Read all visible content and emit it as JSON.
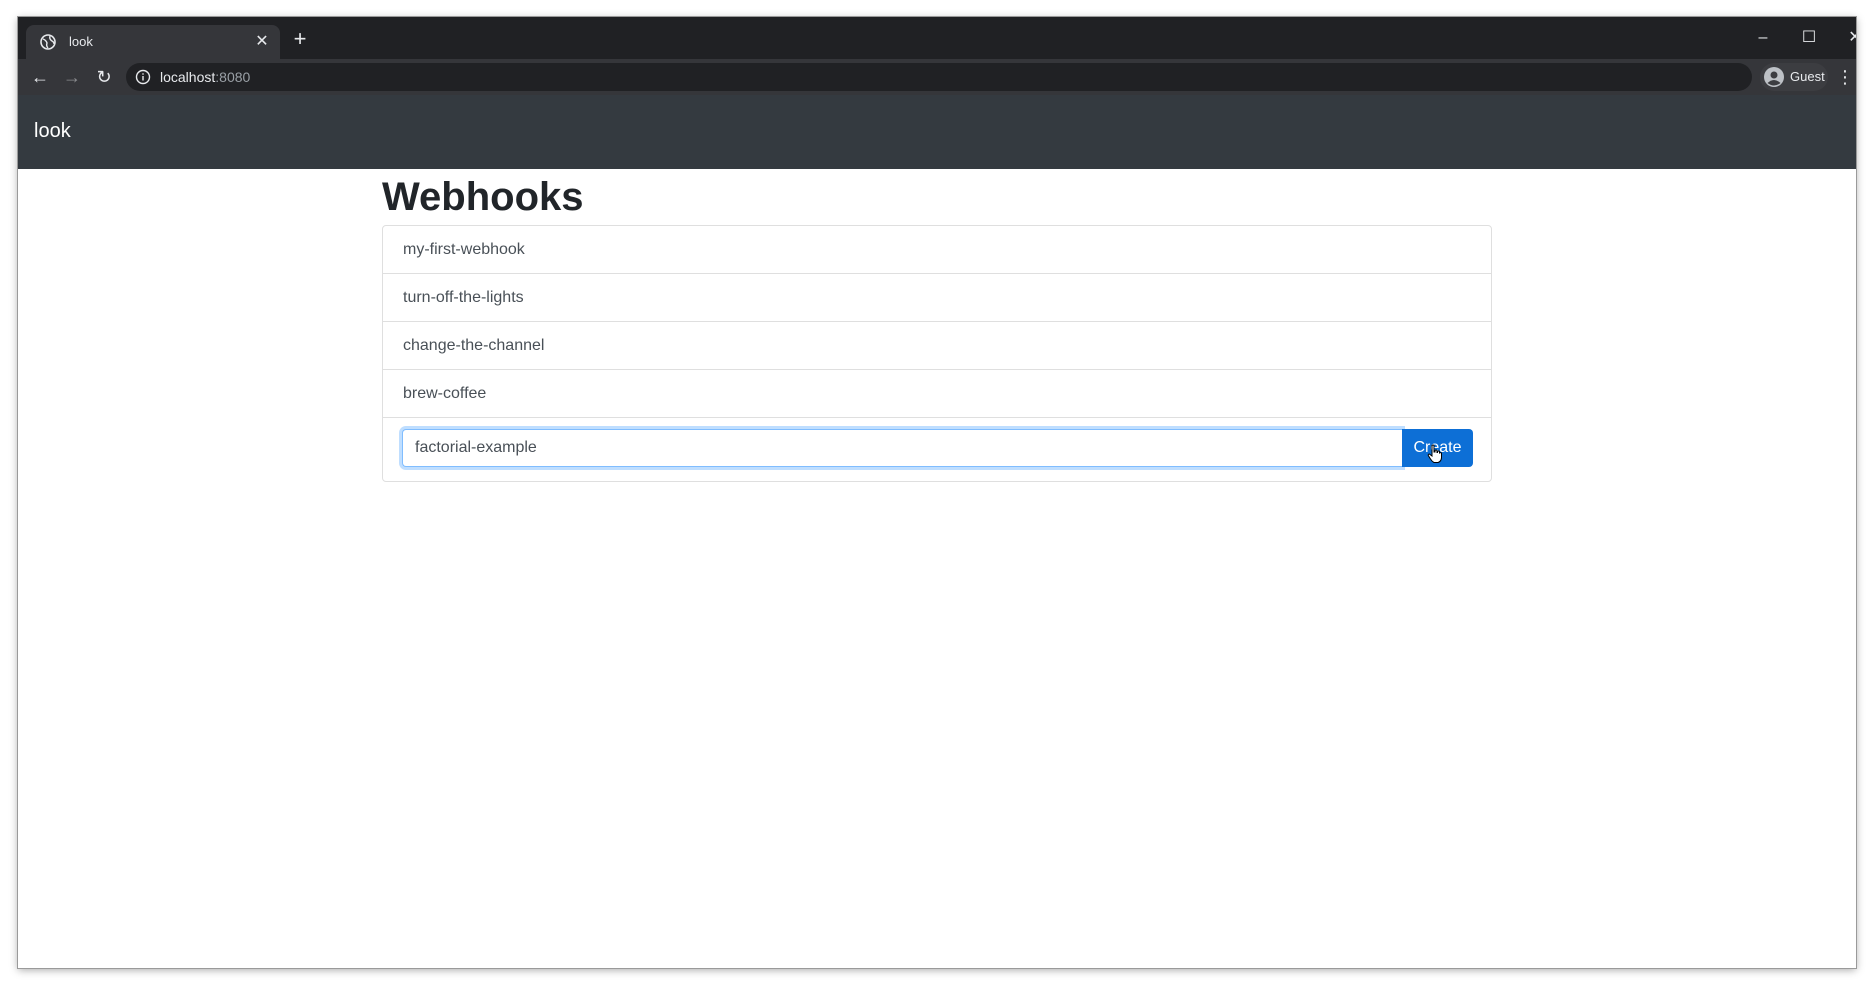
{
  "browser": {
    "tab_title": "look",
    "url_host": "localhost",
    "url_port": ":8080",
    "profile_label": "Guest"
  },
  "app": {
    "brand": "look"
  },
  "page": {
    "title": "Webhooks",
    "webhooks": [
      {
        "name": "my-first-webhook"
      },
      {
        "name": "turn-off-the-lights"
      },
      {
        "name": "change-the-channel"
      },
      {
        "name": "brew-coffee"
      }
    ],
    "create": {
      "input_value": "factorial-example",
      "button_label": "Create"
    }
  },
  "colors": {
    "navbar_bg": "#343a40",
    "accent": "#0d6fd6",
    "focus_ring": "#80bdff"
  }
}
